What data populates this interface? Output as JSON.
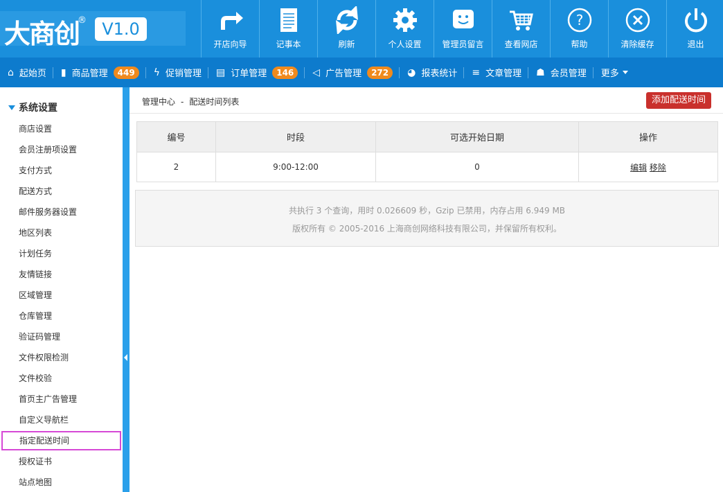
{
  "logo": {
    "name": "大商创",
    "reg": "®",
    "version": "V1.0"
  },
  "topnav": [
    {
      "label": "开店向导",
      "icon": "arrow-forward-icon"
    },
    {
      "label": "记事本",
      "icon": "notepad-icon"
    },
    {
      "label": "刷新",
      "icon": "refresh-icon"
    },
    {
      "label": "个人设置",
      "icon": "gear-icon"
    },
    {
      "label": "管理员留言",
      "icon": "message-smile-icon"
    },
    {
      "label": "查看网店",
      "icon": "cart-icon"
    },
    {
      "label": "帮助",
      "icon": "help-icon"
    },
    {
      "label": "清除缓存",
      "icon": "clear-icon"
    },
    {
      "label": "退出",
      "icon": "power-icon"
    }
  ],
  "subnav": [
    {
      "label": "起始页",
      "icon": "home-icon",
      "glyph": "⌂",
      "badge": ""
    },
    {
      "label": "商品管理",
      "icon": "folder-icon",
      "glyph": "▮",
      "badge": "449"
    },
    {
      "label": "促销管理",
      "icon": "lightning-icon",
      "glyph": "ϟ",
      "badge": ""
    },
    {
      "label": "订单管理",
      "icon": "clipboard-icon",
      "glyph": "▤",
      "badge": "146"
    },
    {
      "label": "广告管理",
      "icon": "megaphone-icon",
      "glyph": "◁",
      "badge": "272"
    },
    {
      "label": "报表统计",
      "icon": "pie-chart-icon",
      "glyph": "◕",
      "badge": ""
    },
    {
      "label": "文章管理",
      "icon": "list-icon",
      "glyph": "≡",
      "badge": ""
    },
    {
      "label": "会员管理",
      "icon": "users-icon",
      "glyph": "☗",
      "badge": ""
    }
  ],
  "more_label": "更多",
  "sidebar": {
    "title": "系统设置",
    "items": [
      "商店设置",
      "会员注册项设置",
      "支付方式",
      "配送方式",
      "邮件服务器设置",
      "地区列表",
      "计划任务",
      "友情链接",
      "区域管理",
      "仓库管理",
      "验证码管理",
      "文件权限检测",
      "文件校验",
      "首页主广告管理",
      "自定义导航栏",
      "指定配送时间",
      "授权证书",
      "站点地图"
    ],
    "active_index": 15
  },
  "breadcrumb": {
    "root": "管理中心",
    "separator": "-",
    "current": "配送时间列表"
  },
  "add_button": "添加配送时间",
  "table": {
    "headers": [
      "编号",
      "时段",
      "可选开始日期",
      "操作"
    ],
    "rows": [
      {
        "id": "2",
        "period": "9:00-12:00",
        "start_date": "0",
        "edit": "编辑",
        "remove": "移除"
      }
    ]
  },
  "footer": {
    "line1": "共执行 3 个查询，用时 0.026609 秒，Gzip 已禁用，内存占用 6.949 MB",
    "line2": "版权所有 © 2005-2016 上海商创网络科技有限公司，并保留所有权利。"
  },
  "colors": {
    "header": "#1a8fdc",
    "subnav": "#0d7bcd",
    "badge": "#f08a1d",
    "add_button": "#c9302c",
    "active_outline": "#d648d6"
  }
}
